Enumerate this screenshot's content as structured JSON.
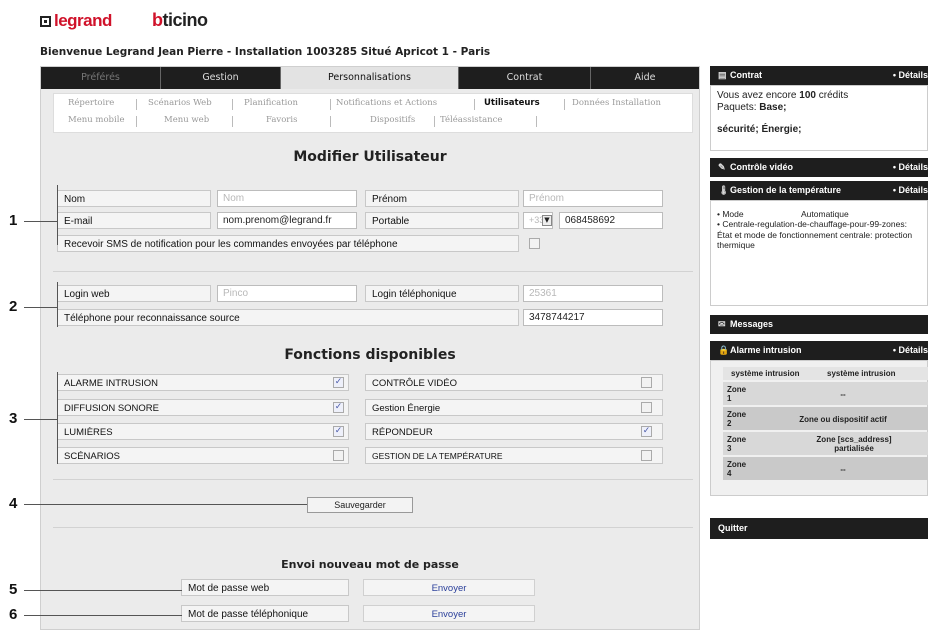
{
  "brand": {
    "logo_left": "legrand",
    "logo_right": "bticino"
  },
  "welcome": "Bienvenue Legrand Jean Pierre - Installation 1003285 Situé Apricot 1 - Paris",
  "tabs": [
    "Préférés",
    "Gestion",
    "Personnalisations",
    "Contrat",
    "Aide"
  ],
  "subnav": {
    "row1": [
      "Répertoire",
      "Scénarios Web",
      "Planification",
      "Notifications et Actions",
      "Utilisateurs",
      "Données Installation"
    ],
    "row2": [
      "Menu mobile",
      "Menu web",
      "Favoris",
      "Dispositifs",
      "Téléassistance"
    ]
  },
  "page_title": "Modifier Utilisateur",
  "user": {
    "nom_label": "Nom",
    "nom_placeholder": "Nom",
    "prenom_label": "Prénom",
    "prenom_placeholder": "Prénom",
    "email_label": "E-mail",
    "email_value": "nom.prenom@legrand.fr",
    "portable_label": "Portable",
    "portable_prefix": "+33",
    "portable_value": "068458692",
    "sms_label": "Recevoir SMS de notification pour les commandes envoyées par téléphone"
  },
  "login": {
    "web_label": "Login web",
    "web_value": "Pinco",
    "tel_label": "Login téléphonique",
    "tel_value": "25361",
    "source_label": "Téléphone pour reconnaissance source",
    "source_value": "3478744217"
  },
  "functions_title": "Fonctions disponibles",
  "functions": [
    {
      "label": "ALARME INTRUSION",
      "checked": true
    },
    {
      "label": "CONTRÔLE VIDÉO",
      "checked": false
    },
    {
      "label": "DIFFUSION SONORE",
      "checked": true
    },
    {
      "label": "Gestion Énergie",
      "checked": false
    },
    {
      "label": "LUMIÈRES",
      "checked": true
    },
    {
      "label": "RÉPONDEUR",
      "checked": true
    },
    {
      "label": "SCÉNARIOS",
      "checked": false
    },
    {
      "label": "GESTION DE LA TEMPÉRATURE",
      "checked": false
    }
  ],
  "save_label": "Sauvegarder",
  "password": {
    "title": "Envoi nouveau mot de passe",
    "web_label": "Mot de passe web",
    "tel_label": "Mot de passe téléphonique",
    "send_label": "Envoyer"
  },
  "callouts": [
    "1",
    "2",
    "3",
    "4",
    "5",
    "6"
  ],
  "right": {
    "contrat": {
      "title": "Contrat",
      "details": "• Détails",
      "line1_a": "Vous avez encore ",
      "line1_b": "100",
      "line1_c": " crédits",
      "line2_a": "Paquets: ",
      "line2_b": "Base;",
      "line3": "sécurité; Énergie;"
    },
    "video": {
      "title": "Contrôle vidéo",
      "details": "• Détails"
    },
    "temp": {
      "title": "Gestion de la température",
      "details": "• Détails",
      "mode_label": "• Mode",
      "mode_value": "Automatique",
      "text": "• Centrale-regulation-de-chauffage-pour-99-zones: État et mode de fonctionnement centrale: protection thermique"
    },
    "messages": {
      "title": "Messages"
    },
    "alarme": {
      "title": "Alarme intrusion",
      "details": "• Détails",
      "head1": "système intrusion",
      "head2": "système intrusion",
      "rows": [
        {
          "zone": "Zone 1",
          "state": "--"
        },
        {
          "zone": "Zone 2",
          "state": "Zone ou dispositif actif"
        },
        {
          "zone": "Zone 3",
          "state": "Zone [scs_address] partialisée"
        },
        {
          "zone": "Zone 4",
          "state": "--"
        }
      ]
    },
    "quit": "Quitter"
  },
  "colors": {
    "dark_bar": "#1e1e1e",
    "panel_bg": "#ebebeb",
    "brand_red": "#d0122a",
    "link_blue": "#2a3f9a"
  }
}
